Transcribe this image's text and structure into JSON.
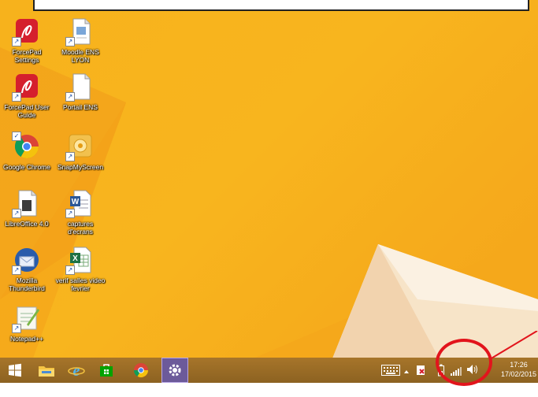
{
  "desktop": {
    "icons": [
      {
        "label_line1": "ForcePad",
        "label_line2": "Settings"
      },
      {
        "label_line1": "Moodle ENS",
        "label_line2": "LYON"
      },
      {
        "label_line1": "ForcePad User",
        "label_line2": "Guide"
      },
      {
        "label_line1": "Portail ENS",
        "label_line2": ""
      },
      {
        "label_line1": "Google Chrome",
        "label_line2": ""
      },
      {
        "label_line1": "SnapMyScreen",
        "label_line2": ""
      },
      {
        "label_line1": "LibreOffice 4.0",
        "label_line2": ""
      },
      {
        "label_line1": "captures d'ecrans",
        "label_line2": ""
      },
      {
        "label_line1": "Mozilla",
        "label_line2": "Thunderbird"
      },
      {
        "label_line1": "verif salles video",
        "label_line2": "fevrier"
      },
      {
        "label_line1": "Notepad++",
        "label_line2": ""
      }
    ]
  },
  "taskbar": {
    "clock_time": "17:26",
    "clock_date": "17/02/2015"
  },
  "colors": {
    "wallpaper": "#f7b21c",
    "taskbar": "#9a6b25",
    "highlight_circle": "#e2141c",
    "active_app": "#6c5a9a"
  },
  "icon_names": {
    "start": "windows-logo-icon",
    "explorer": "file-explorer-icon",
    "ie": "internet-explorer-icon",
    "store": "store-icon",
    "chrome": "chrome-icon",
    "settings": "settings-gear-icon",
    "tray": [
      "keyboard-icon",
      "show-hidden-icons-icon",
      "flag-action-center-icon",
      "battery-icon",
      "signal-icon",
      "volume-icon"
    ]
  }
}
